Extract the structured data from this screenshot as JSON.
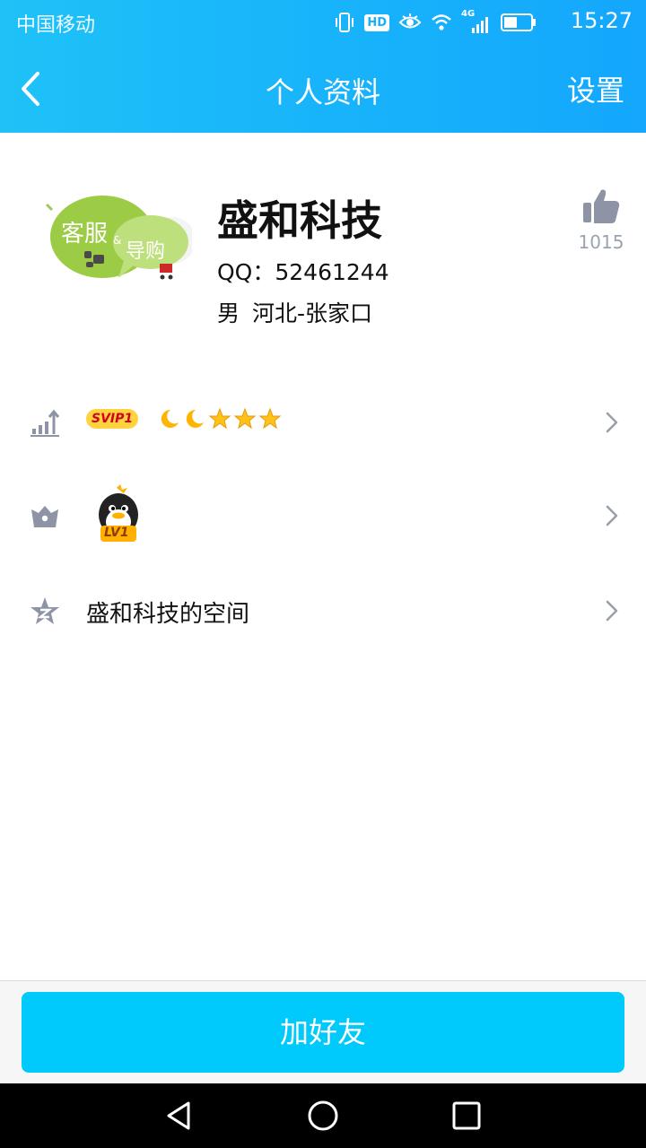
{
  "status_bar": {
    "carrier": "中国移动",
    "network": "4G",
    "hd_label": "HD",
    "time": "15:27"
  },
  "nav": {
    "title": "个人资料",
    "settings_label": "设置"
  },
  "profile": {
    "nickname": "盛和科技",
    "qq_label": "QQ：",
    "qq_number": "52461244",
    "gender": "男",
    "location": "河北-张家口",
    "likes": "1015",
    "avatar_text_1": "客服",
    "avatar_text_2": "导购"
  },
  "rows": {
    "vip_badge": "SVIP1",
    "level_label": "LV1",
    "space_label": "盛和科技的空间"
  },
  "actions": {
    "add_friend": "加好友"
  },
  "colors": {
    "header_start": "#1ec2f7",
    "header_end": "#14a7fc",
    "button": "#00cafc",
    "icon_gray": "#8e94a6"
  },
  "icons": [
    "back-arrow-icon",
    "vibrate-icon",
    "eye-icon",
    "wifi-icon",
    "signal-icon",
    "battery-icon",
    "thumbs-up-icon",
    "level-chart-icon",
    "crown-icon",
    "qzone-star-icon",
    "chevron-right-icon",
    "moon-icon",
    "star-icon",
    "penguin-icon",
    "back-triangle-icon",
    "home-circle-icon",
    "recents-square-icon"
  ]
}
